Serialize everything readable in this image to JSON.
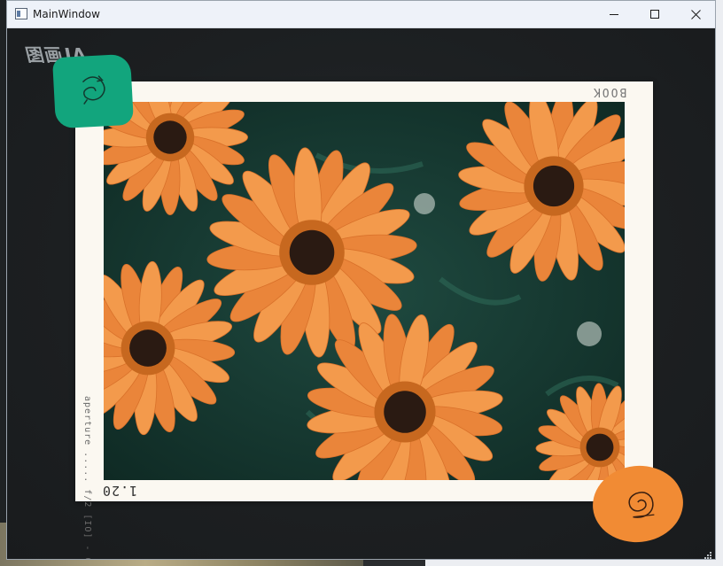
{
  "window": {
    "title": "MainWindow",
    "controls": {
      "minimize": "minimize-icon",
      "maximize": "maximize-icon",
      "close": "close-icon"
    }
  },
  "canvas": {
    "brand_text": "AI画图",
    "polaroid": {
      "tape_label": "BOOK",
      "side_caption": "aperture ..... f/2 [IO] - 0",
      "photo_number": "1.20",
      "photo_subject": "orange daisies"
    },
    "stickers": {
      "green": {
        "icon": "swirl-doodle-icon",
        "color": "#12a57d"
      },
      "orange": {
        "icon": "spiral-doodle-icon",
        "color": "#f18b34"
      }
    }
  },
  "colors": {
    "background": "#1e2123",
    "titlebar": "#eef2f9",
    "paper": "#fbf8f1",
    "flower": "#f08a3e",
    "foliage": "#16362f"
  }
}
